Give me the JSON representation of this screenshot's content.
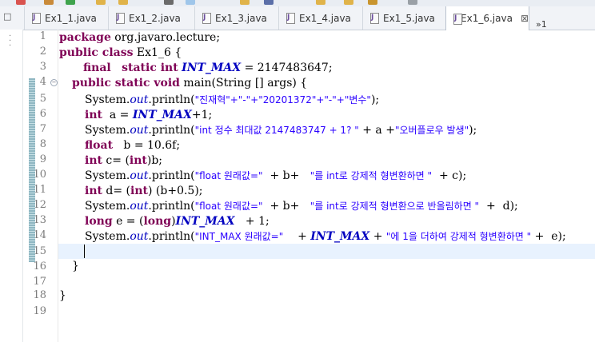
{
  "tabs": [
    {
      "label": "Ex1_1.java",
      "active": false
    },
    {
      "label": "Ex1_2.java",
      "active": false
    },
    {
      "label": "Ex1_3.java",
      "active": false
    },
    {
      "label": "Ex1_4.java",
      "active": false
    },
    {
      "label": "Ex1_5.java",
      "active": false
    },
    {
      "label": "Ex1_6.java",
      "active": true
    }
  ],
  "tab_close": "⊠",
  "overflow_label": "»1",
  "line_numbers": [
    "1",
    "2",
    "3",
    "4",
    "5",
    "6",
    "7",
    "8",
    "9",
    "10",
    "11",
    "12",
    "13",
    "14",
    "15",
    "16",
    "17",
    "18",
    "19"
  ],
  "code": {
    "l1": {
      "kw": "package",
      "rest": " org.javaro.lecture;"
    },
    "l2": {
      "kw": "public class",
      "rest": " Ex1_6 {"
    },
    "l3": {
      "kw1": "final",
      "kw2": "static int",
      "field": "INT_MAX",
      "rest": " = 2147483647;"
    },
    "l4": {
      "kw": "public static void",
      "rest": " main(String [] args) {"
    },
    "l5": {
      "pre": "System.",
      "out": "out",
      "mid": ".println(",
      "str": "\"진재혁\"+\"-\"+\"20201372\"+\"-\"+\"변수\"",
      "post": ");"
    },
    "l6": {
      "kw": "int",
      "mid": "  a = ",
      "field": "INT_MAX",
      "post": "+1;"
    },
    "l7": {
      "pre": "System.",
      "out": "out",
      "mid": ".println(",
      "str": "\"int 정수 최대값 2147483747 + 1? \"",
      "post": " + a +",
      "str2": "\"오버플로우 발생\"",
      "post2": ");"
    },
    "l8": {
      "kw": "float",
      "rest": "   b = 10.6f;"
    },
    "l9": {
      "kw": "int",
      "mid": " c= (",
      "kw2": "int",
      "post": ")b;"
    },
    "l10": {
      "pre": "System.",
      "out": "out",
      "mid": ".println(",
      "str": "\"float 원래값=\"",
      "post": "  + b+   ",
      "str2": "\"를 int로 강제적 형변환하면 \"",
      "post2": "  + c);"
    },
    "l11": {
      "kw": "int",
      "mid": " d= (",
      "kw2": "int",
      "post": ") (b+0.5);"
    },
    "l12": {
      "pre": "System.",
      "out": "out",
      "mid": ".println(",
      "str": "\"float 원래값=\"",
      "post": "  + b+   ",
      "str2": "\"를 int로 강제적 형변환으로 반올림하면 \"",
      "post2": "  +  d);"
    },
    "l13": {
      "kw": "long",
      "mid": " e = (",
      "kw2": "long",
      "post0": ")",
      "field": "INT_MAX",
      "post": "   + 1;"
    },
    "l14": {
      "pre": "System.",
      "out": "out",
      "mid": ".println(",
      "str": "\"INT_MAX 원래값=\"",
      "post": "    + ",
      "field": "INT_MAX",
      "post2": " + ",
      "str2": "\"에 1을 더하여 강제적 형변환하면 \"",
      "post3": " +  e);"
    },
    "l16": {
      "text": "}"
    },
    "l18": {
      "text": "}"
    }
  }
}
